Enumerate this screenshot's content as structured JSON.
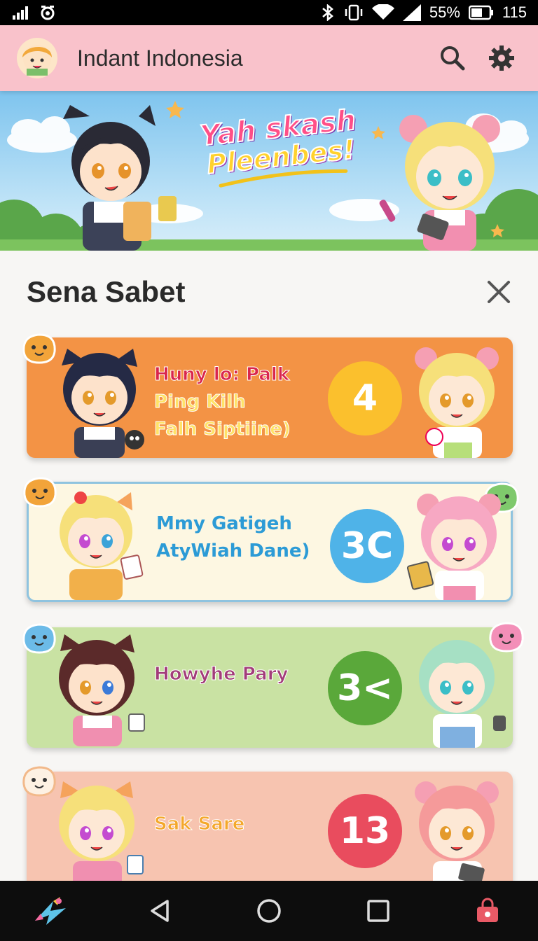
{
  "status_bar": {
    "battery_percent": "55%",
    "right_number": "115"
  },
  "app_bar": {
    "title": "Indant Indonesia",
    "icons": [
      "search-icon",
      "gear-icon"
    ]
  },
  "hero": {
    "headline_line1": "Yah skash",
    "headline_line2": "Pleenbes!"
  },
  "section": {
    "title": "Sena Sabet",
    "close_icon": "close-icon"
  },
  "cards": [
    {
      "lines": [
        "Huny lo: Palk",
        "Ping Kilh",
        "Falh Siptiine)"
      ],
      "badge": "4",
      "badge_color": "#fbc02d",
      "bg": "#f39345"
    },
    {
      "lines": [
        "Mmy Gatigeh",
        "AtyWiah Dane)"
      ],
      "badge": "3C",
      "badge_color": "#4fb3e8",
      "bg": "#fdf7e2"
    },
    {
      "lines": [
        "Howyhe Pary"
      ],
      "badge": "3<",
      "badge_color": "#5aa83a",
      "bg": "#c9e2a3"
    },
    {
      "lines": [
        "Sak Sare"
      ],
      "badge": "13",
      "badge_color": "#e94c5e",
      "bg": "#f7c4b0"
    }
  ],
  "nav_bar": {
    "icons": [
      "app-logo-icon",
      "back-icon",
      "home-icon",
      "recents-icon",
      "shop-bag-icon"
    ]
  }
}
